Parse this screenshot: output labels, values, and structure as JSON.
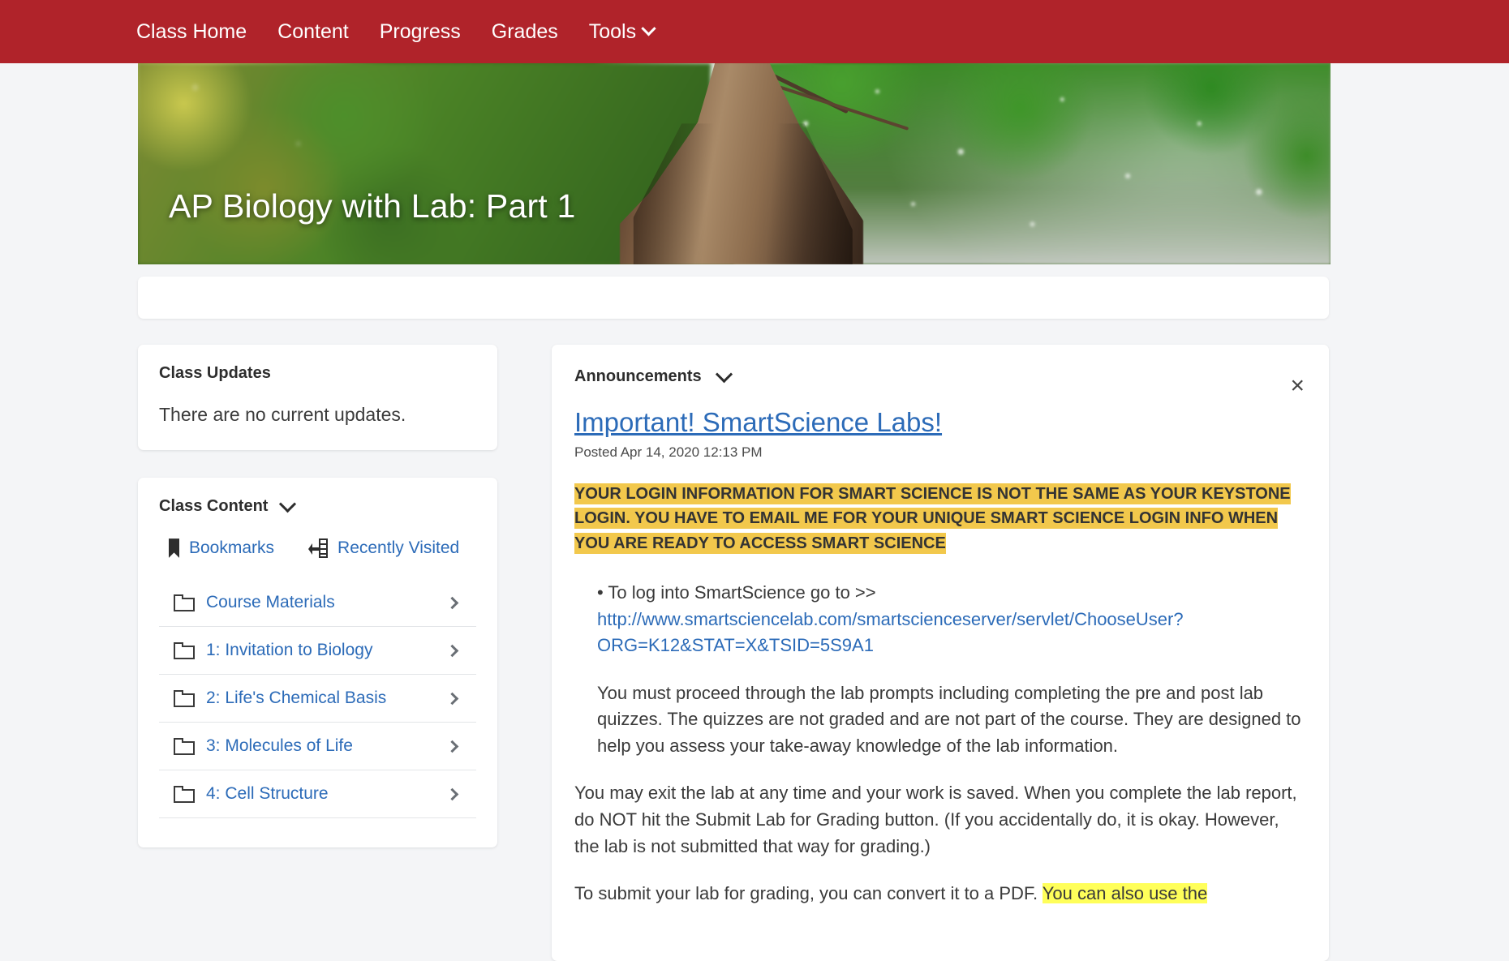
{
  "topnav": {
    "items": [
      {
        "label": "Class Home",
        "has_caret": false
      },
      {
        "label": "Content",
        "has_caret": false
      },
      {
        "label": "Progress",
        "has_caret": false
      },
      {
        "label": "Grades",
        "has_caret": false
      },
      {
        "label": "Tools",
        "has_caret": true
      }
    ],
    "brand_color": "#b0232a"
  },
  "banner": {
    "title": "AP Biology with Lab: Part 1",
    "image_description": "forest canopy with fallen tree trunk"
  },
  "class_updates": {
    "heading": "Class Updates",
    "body": "There are no current updates."
  },
  "class_content": {
    "heading": "Class Content",
    "quicklinks": [
      {
        "label": "Bookmarks",
        "icon": "bookmark-icon"
      },
      {
        "label": "Recently Visited",
        "icon": "recently-visited-icon"
      }
    ],
    "folders": [
      {
        "label": "Course Materials"
      },
      {
        "label": "1: Invitation to Biology"
      },
      {
        "label": "2: Life's Chemical Basis"
      },
      {
        "label": "3: Molecules of Life"
      },
      {
        "label": "4: Cell Structure"
      }
    ]
  },
  "announcements": {
    "section_label": "Announcements",
    "title": "Important! SmartScience Labs!",
    "posted": "Posted Apr 14, 2020 12:13 PM",
    "close_label": "×",
    "highlight_color": "#f2c84c",
    "highlight_color_2": "#ffff5a",
    "highlighted_notice": "YOUR LOGIN INFORMATION FOR SMART SCIENCE IS NOT THE SAME AS YOUR KEYSTONE LOGIN. YOU HAVE TO EMAIL ME FOR YOUR UNIQUE SMART SCIENCE LOGIN INFO WHEN YOU ARE READY TO ACCESS SMART SCIENCE",
    "bullet_line": "• To log into SmartScience go to >>",
    "link_text": "http://www.smartsciencelab.com/smartscienceserver/servlet/ChooseUser?ORG=K12&STAT=X&TSID=5S9A1",
    "paragraph_1": "You must proceed through the lab prompts including completing the pre and post lab quizzes. The quizzes are not graded and are not part of the course. They are designed to help you assess your take-away knowledge of the lab information.",
    "paragraph_2": "You may exit the lab at any time and your work is saved. When you complete the lab report,  do NOT hit the Submit Lab for Grading button. (If you accidentally do, it is okay. However, the lab is not submitted that way for grading.)",
    "paragraph_3_plain": "To submit your lab for grading, you can convert it to a PDF. ",
    "paragraph_3_highlight": "You can also use the"
  }
}
